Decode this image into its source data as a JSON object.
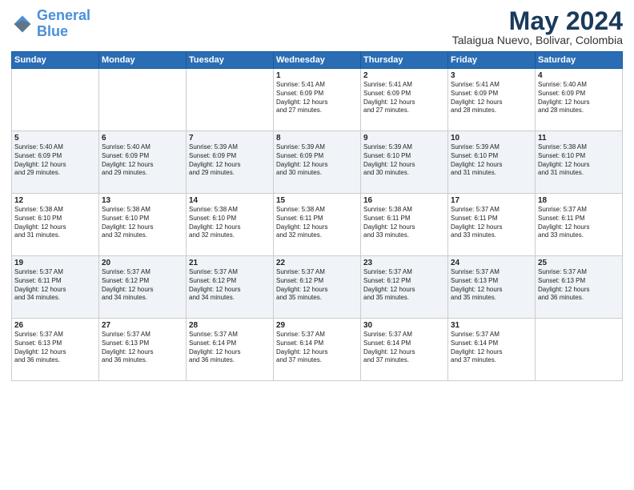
{
  "header": {
    "logo_line1": "General",
    "logo_line2": "Blue",
    "title": "May 2024",
    "subtitle": "Talaigua Nuevo, Bolivar, Colombia"
  },
  "days_of_week": [
    "Sunday",
    "Monday",
    "Tuesday",
    "Wednesday",
    "Thursday",
    "Friday",
    "Saturday"
  ],
  "weeks": [
    [
      {
        "day": "",
        "info": ""
      },
      {
        "day": "",
        "info": ""
      },
      {
        "day": "",
        "info": ""
      },
      {
        "day": "1",
        "info": "Sunrise: 5:41 AM\nSunset: 6:09 PM\nDaylight: 12 hours\nand 27 minutes."
      },
      {
        "day": "2",
        "info": "Sunrise: 5:41 AM\nSunset: 6:09 PM\nDaylight: 12 hours\nand 27 minutes."
      },
      {
        "day": "3",
        "info": "Sunrise: 5:41 AM\nSunset: 6:09 PM\nDaylight: 12 hours\nand 28 minutes."
      },
      {
        "day": "4",
        "info": "Sunrise: 5:40 AM\nSunset: 6:09 PM\nDaylight: 12 hours\nand 28 minutes."
      }
    ],
    [
      {
        "day": "5",
        "info": "Sunrise: 5:40 AM\nSunset: 6:09 PM\nDaylight: 12 hours\nand 29 minutes."
      },
      {
        "day": "6",
        "info": "Sunrise: 5:40 AM\nSunset: 6:09 PM\nDaylight: 12 hours\nand 29 minutes."
      },
      {
        "day": "7",
        "info": "Sunrise: 5:39 AM\nSunset: 6:09 PM\nDaylight: 12 hours\nand 29 minutes."
      },
      {
        "day": "8",
        "info": "Sunrise: 5:39 AM\nSunset: 6:09 PM\nDaylight: 12 hours\nand 30 minutes."
      },
      {
        "day": "9",
        "info": "Sunrise: 5:39 AM\nSunset: 6:10 PM\nDaylight: 12 hours\nand 30 minutes."
      },
      {
        "day": "10",
        "info": "Sunrise: 5:39 AM\nSunset: 6:10 PM\nDaylight: 12 hours\nand 31 minutes."
      },
      {
        "day": "11",
        "info": "Sunrise: 5:38 AM\nSunset: 6:10 PM\nDaylight: 12 hours\nand 31 minutes."
      }
    ],
    [
      {
        "day": "12",
        "info": "Sunrise: 5:38 AM\nSunset: 6:10 PM\nDaylight: 12 hours\nand 31 minutes."
      },
      {
        "day": "13",
        "info": "Sunrise: 5:38 AM\nSunset: 6:10 PM\nDaylight: 12 hours\nand 32 minutes."
      },
      {
        "day": "14",
        "info": "Sunrise: 5:38 AM\nSunset: 6:10 PM\nDaylight: 12 hours\nand 32 minutes."
      },
      {
        "day": "15",
        "info": "Sunrise: 5:38 AM\nSunset: 6:11 PM\nDaylight: 12 hours\nand 32 minutes."
      },
      {
        "day": "16",
        "info": "Sunrise: 5:38 AM\nSunset: 6:11 PM\nDaylight: 12 hours\nand 33 minutes."
      },
      {
        "day": "17",
        "info": "Sunrise: 5:37 AM\nSunset: 6:11 PM\nDaylight: 12 hours\nand 33 minutes."
      },
      {
        "day": "18",
        "info": "Sunrise: 5:37 AM\nSunset: 6:11 PM\nDaylight: 12 hours\nand 33 minutes."
      }
    ],
    [
      {
        "day": "19",
        "info": "Sunrise: 5:37 AM\nSunset: 6:11 PM\nDaylight: 12 hours\nand 34 minutes."
      },
      {
        "day": "20",
        "info": "Sunrise: 5:37 AM\nSunset: 6:12 PM\nDaylight: 12 hours\nand 34 minutes."
      },
      {
        "day": "21",
        "info": "Sunrise: 5:37 AM\nSunset: 6:12 PM\nDaylight: 12 hours\nand 34 minutes."
      },
      {
        "day": "22",
        "info": "Sunrise: 5:37 AM\nSunset: 6:12 PM\nDaylight: 12 hours\nand 35 minutes."
      },
      {
        "day": "23",
        "info": "Sunrise: 5:37 AM\nSunset: 6:12 PM\nDaylight: 12 hours\nand 35 minutes."
      },
      {
        "day": "24",
        "info": "Sunrise: 5:37 AM\nSunset: 6:13 PM\nDaylight: 12 hours\nand 35 minutes."
      },
      {
        "day": "25",
        "info": "Sunrise: 5:37 AM\nSunset: 6:13 PM\nDaylight: 12 hours\nand 36 minutes."
      }
    ],
    [
      {
        "day": "26",
        "info": "Sunrise: 5:37 AM\nSunset: 6:13 PM\nDaylight: 12 hours\nand 36 minutes."
      },
      {
        "day": "27",
        "info": "Sunrise: 5:37 AM\nSunset: 6:13 PM\nDaylight: 12 hours\nand 36 minutes."
      },
      {
        "day": "28",
        "info": "Sunrise: 5:37 AM\nSunset: 6:14 PM\nDaylight: 12 hours\nand 36 minutes."
      },
      {
        "day": "29",
        "info": "Sunrise: 5:37 AM\nSunset: 6:14 PM\nDaylight: 12 hours\nand 37 minutes."
      },
      {
        "day": "30",
        "info": "Sunrise: 5:37 AM\nSunset: 6:14 PM\nDaylight: 12 hours\nand 37 minutes."
      },
      {
        "day": "31",
        "info": "Sunrise: 5:37 AM\nSunset: 6:14 PM\nDaylight: 12 hours\nand 37 minutes."
      },
      {
        "day": "",
        "info": ""
      }
    ]
  ]
}
